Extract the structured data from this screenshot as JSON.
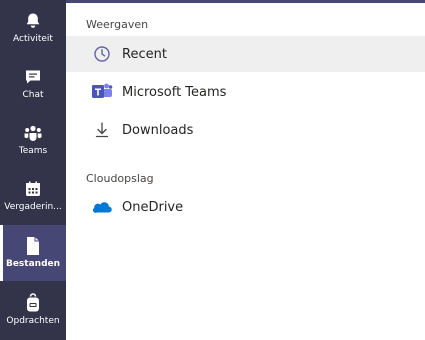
{
  "rail": {
    "items": [
      {
        "label": "Activiteit",
        "icon": "bell-icon",
        "active": false
      },
      {
        "label": "Chat",
        "icon": "chat-icon",
        "active": false
      },
      {
        "label": "Teams",
        "icon": "teams-people-icon",
        "active": false
      },
      {
        "label": "Vergaderin...",
        "icon": "calendar-icon",
        "active": false
      },
      {
        "label": "Bestanden",
        "icon": "file-icon",
        "active": true
      },
      {
        "label": "Opdrachten",
        "icon": "backpack-icon",
        "active": false
      }
    ]
  },
  "panel": {
    "views_title": "Weergaven",
    "views": [
      {
        "label": "Recent",
        "icon": "clock-icon",
        "selected": true
      },
      {
        "label": "Microsoft Teams",
        "icon": "microsoft-teams-icon",
        "selected": false
      },
      {
        "label": "Downloads",
        "icon": "download-icon",
        "selected": false
      }
    ],
    "storage_title": "Cloudopslag",
    "storage": [
      {
        "label": "OneDrive",
        "icon": "onedrive-icon",
        "selected": false
      }
    ]
  },
  "colors": {
    "rail_bg": "#33344a",
    "rail_active_bg": "#464775",
    "accent": "#6264a7",
    "onedrive_blue": "#0078d4",
    "selected_row_bg": "#f0efef"
  }
}
